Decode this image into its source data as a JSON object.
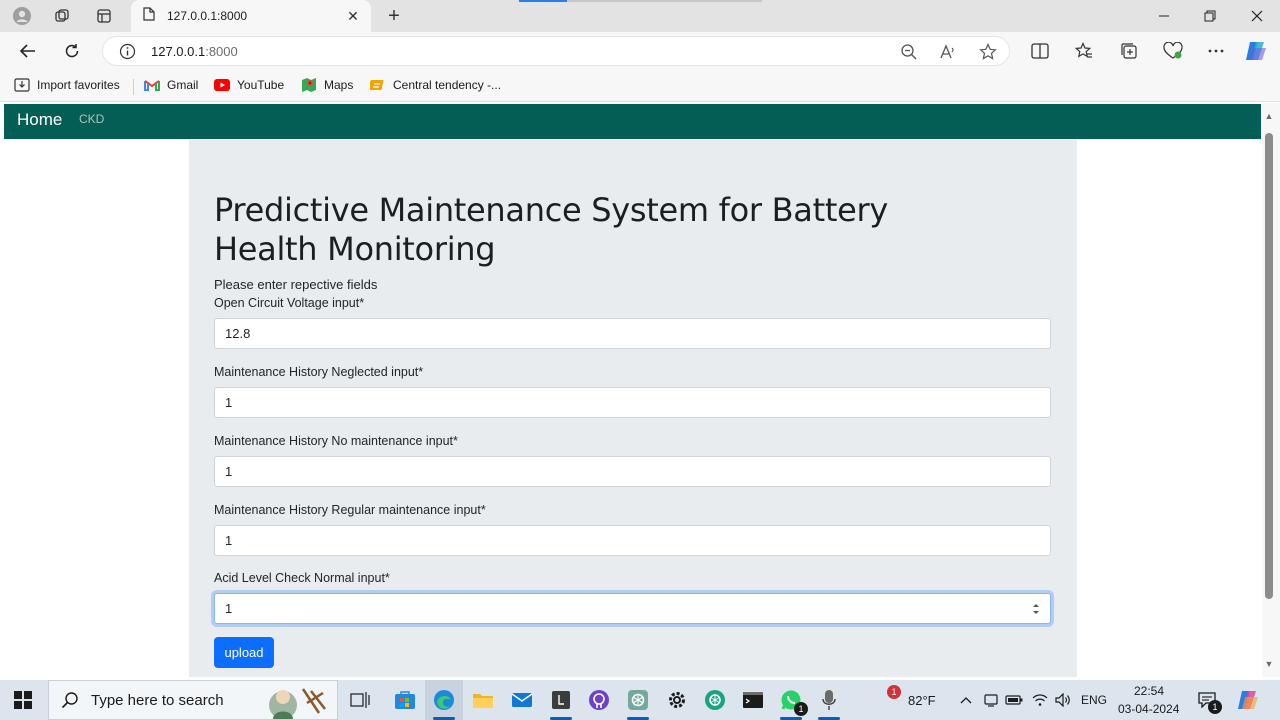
{
  "browser": {
    "tab_title": "127.0.0.1:8000",
    "url_host": "127.0.0.1",
    "url_port": ":8000",
    "favorites": [
      {
        "label": "Import favorites",
        "icon": "import-icon"
      },
      {
        "label": "Gmail",
        "icon": "gmail-icon"
      },
      {
        "label": "YouTube",
        "icon": "youtube-icon"
      },
      {
        "label": "Maps",
        "icon": "maps-icon"
      },
      {
        "label": "Central tendency -...",
        "icon": "bookmark-icon"
      }
    ],
    "accent": "#2b7de9"
  },
  "app": {
    "brand": "Home",
    "nav_link": "CKD",
    "nav_color": "#055e55",
    "title": "Predictive Maintenance System for Battery Health Monitoring",
    "subtitle": "Please enter repective fields",
    "fields": [
      {
        "label": "Open Circuit Voltage input*",
        "value": "12.8"
      },
      {
        "label": "Maintenance History Neglected input*",
        "value": "1"
      },
      {
        "label": "Maintenance History No maintenance input*",
        "value": "1"
      },
      {
        "label": "Maintenance History Regular maintenance input*",
        "value": "1"
      },
      {
        "label": "Acid Level Check Normal input*",
        "value": "1"
      }
    ],
    "submit_label": "upload",
    "button_color": "#0d6efd"
  },
  "taskbar": {
    "search_placeholder": "Type here to search",
    "weather": "82°F",
    "weather_badge": "1",
    "language": "ENG",
    "time": "22:54",
    "date": "03-04-2024",
    "whatsapp_badge": "1",
    "notification_badge": "1"
  }
}
